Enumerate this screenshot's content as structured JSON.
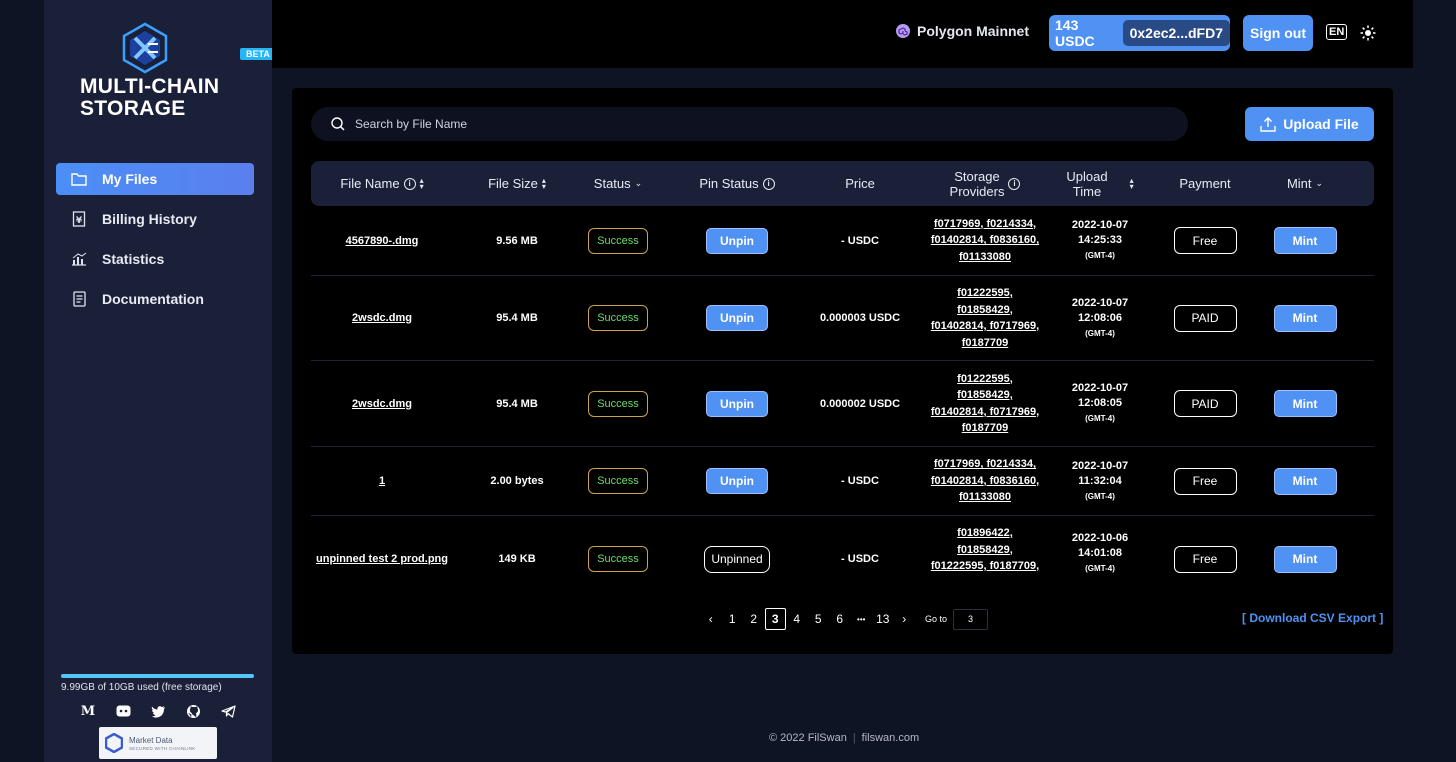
{
  "brand": {
    "line1": "MULTI-CHAIN",
    "line2": "STORAGE",
    "beta": "BETA"
  },
  "nav": [
    {
      "label": "My Files",
      "icon": "folder-icon",
      "active": true
    },
    {
      "label": "Billing History",
      "icon": "billing-icon",
      "active": false
    },
    {
      "label": "Statistics",
      "icon": "statistics-icon",
      "active": false
    },
    {
      "label": "Documentation",
      "icon": "document-icon",
      "active": false
    }
  ],
  "storage": {
    "text": "9.99GB of 10GB used (free storage)",
    "used_fraction": 0.999
  },
  "social": [
    "medium-icon",
    "discord-icon",
    "twitter-icon",
    "github-icon",
    "telegram-icon"
  ],
  "chainlink": {
    "line1": "Market Data",
    "line2": "SECURED WITH CHAINLINK"
  },
  "topbar": {
    "network": "Polygon Mainnet",
    "balance": "143 USDC",
    "address": "0x2ec2...dFD7",
    "signout": "Sign out",
    "lang": "EN"
  },
  "search": {
    "placeholder": "Search by File Name"
  },
  "upload_label": "Upload File",
  "columns": {
    "file_name": "File Name",
    "file_size": "File Size",
    "status": "Status",
    "pin_status": "Pin Status",
    "price": "Price",
    "storage_providers_1": "Storage",
    "storage_providers_2": "Providers",
    "upload_time_1": "Upload",
    "upload_time_2": "Time",
    "payment": "Payment",
    "mint": "Mint"
  },
  "rows": [
    {
      "name": "4567890-.dmg",
      "size": "9.56 MB",
      "status": "Success",
      "pin": "Unpin",
      "price": "- USDC",
      "providers": [
        "f0717969, f0214334,",
        "f01402814, f0836160,",
        "f01133080"
      ],
      "date": "2022-10-07",
      "time": "14:25:33",
      "tz": "(GMT-4)",
      "payment": "Free",
      "mint": "Mint"
    },
    {
      "name": "2wsdc.dmg",
      "size": "95.4 MB",
      "status": "Success",
      "pin": "Unpin",
      "price": "0.000003 USDC",
      "providers": [
        "f01222595,",
        "f01858429,",
        "f01402814, f0717969,",
        "f0187709"
      ],
      "date": "2022-10-07",
      "time": "12:08:06",
      "tz": "(GMT-4)",
      "payment": "PAID",
      "mint": "Mint"
    },
    {
      "name": "2wsdc.dmg",
      "size": "95.4 MB",
      "status": "Success",
      "pin": "Unpin",
      "price": "0.000002 USDC",
      "providers": [
        "f01222595,",
        "f01858429,",
        "f01402814, f0717969,",
        "f0187709"
      ],
      "date": "2022-10-07",
      "time": "12:08:05",
      "tz": "(GMT-4)",
      "payment": "PAID",
      "mint": "Mint"
    },
    {
      "name": "1",
      "size": "2.00 bytes",
      "status": "Success",
      "pin": "Unpin",
      "price": "- USDC",
      "providers": [
        "f0717969, f0214334,",
        "f01402814, f0836160,",
        "f01133080"
      ],
      "date": "2022-10-07",
      "time": "11:32:04",
      "tz": "(GMT-4)",
      "payment": "Free",
      "mint": "Mint"
    },
    {
      "name": "unpinned test 2 prod.png",
      "size": "149 KB",
      "status": "Success",
      "pin": "Unpinned",
      "price": "- USDC",
      "providers": [
        "f01896422,",
        "f01858429,",
        "f01222595, f0187709,"
      ],
      "date": "2022-10-06",
      "time": "14:01:08",
      "tz": "(GMT-4)",
      "payment": "Free",
      "mint": "Mint"
    }
  ],
  "pagination": {
    "pages": [
      "1",
      "2",
      "3",
      "4",
      "5",
      "6"
    ],
    "ellipsis": "•••",
    "last": "13",
    "current": "3",
    "goto_label": "Go to",
    "goto_value": "3"
  },
  "csv": {
    "open": "[",
    "label": "Download CSV Export",
    "close": "]"
  },
  "footer": {
    "copyright": "© 2022 FilSwan",
    "sep": "|",
    "site": "filswan.com"
  }
}
